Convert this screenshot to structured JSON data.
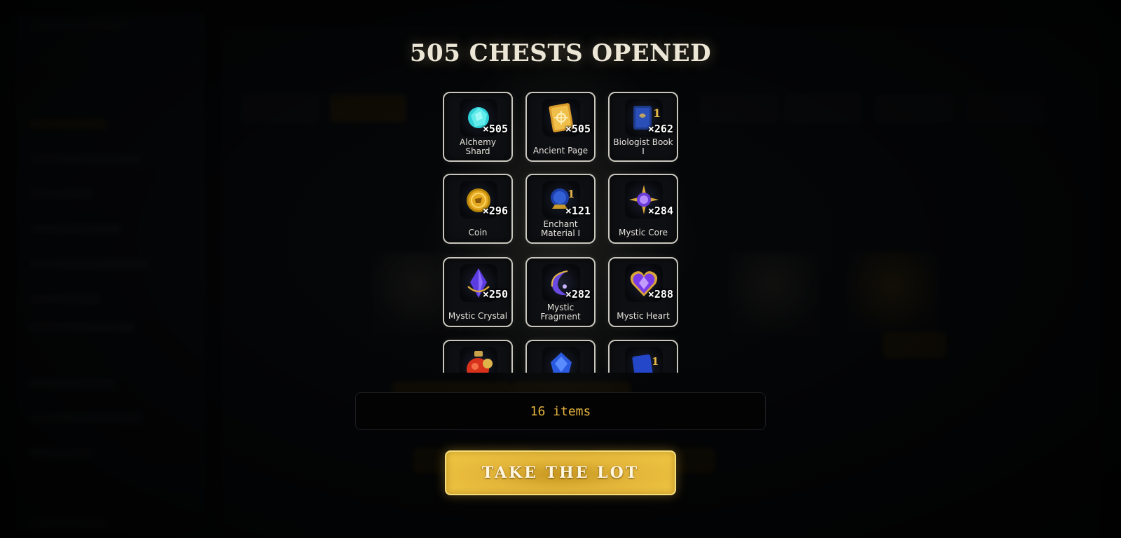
{
  "modal": {
    "title": "505 CHESTS OPENED",
    "items_count_label": "16 items",
    "take_button_label": "TAKE THE LOT",
    "accent_color": "#e3b23c"
  },
  "items": [
    {
      "name": "Alchemy Shard",
      "qty": "×505",
      "icon": "alchemy-shard-icon"
    },
    {
      "name": "Ancient Page",
      "qty": "×505",
      "icon": "ancient-page-icon"
    },
    {
      "name": "Biologist Book I",
      "qty": "×262",
      "icon": "biologist-book-icon"
    },
    {
      "name": "Coin",
      "qty": "×296",
      "icon": "coin-icon"
    },
    {
      "name": "Enchant Material I",
      "qty": "×121",
      "icon": "enchant-material-icon"
    },
    {
      "name": "Mystic Core",
      "qty": "×284",
      "icon": "mystic-core-icon"
    },
    {
      "name": "Mystic Crystal",
      "qty": "×250",
      "icon": "mystic-crystal-icon"
    },
    {
      "name": "Mystic Fragment",
      "qty": "×282",
      "icon": "mystic-fragment-icon"
    },
    {
      "name": "Mystic Heart",
      "qty": "×288",
      "icon": "mystic-heart-icon"
    },
    {
      "name": "",
      "qty": "",
      "icon": "potion-icon"
    },
    {
      "name": "",
      "qty": "",
      "icon": "blue-rune-icon"
    },
    {
      "name": "",
      "qty": "",
      "icon": "blue-book-icon"
    }
  ]
}
